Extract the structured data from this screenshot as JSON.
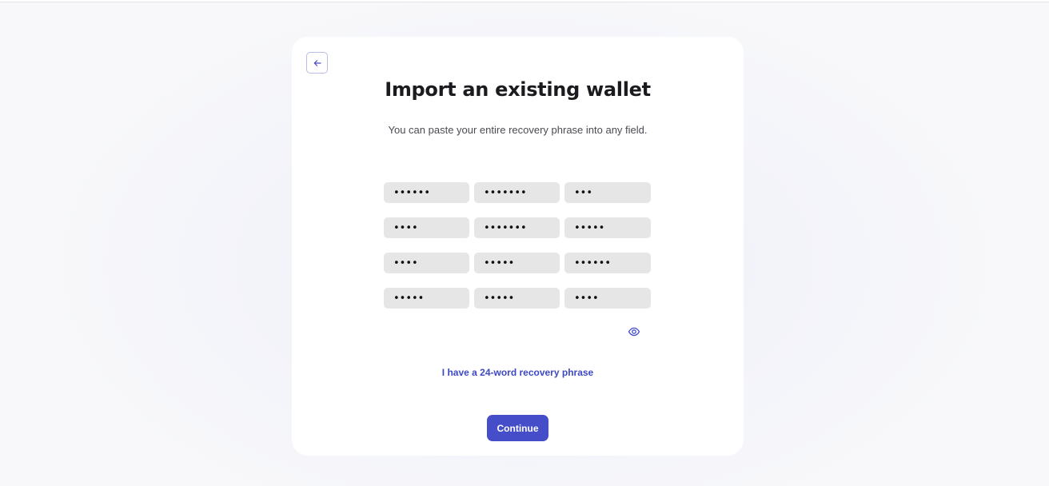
{
  "header": {
    "title": "Import an existing wallet",
    "subtitle": "You can paste your entire recovery phrase into any field."
  },
  "recovery_phrase": {
    "masked_words": [
      "••••••",
      "•••••••",
      "•••",
      "••••",
      "•••••••",
      "•••••",
      "••••",
      "•••••",
      "••••••",
      "•••••",
      "•••••",
      "••••"
    ]
  },
  "actions": {
    "alt_phrase_link": "I have a 24-word recovery phrase",
    "continue_label": "Continue"
  },
  "icons": {
    "back": "arrow-left-icon",
    "visibility": "eye-icon"
  },
  "colors": {
    "accent": "#454dc8",
    "link": "#3d48c4",
    "field_bg": "#e6e6e6"
  }
}
